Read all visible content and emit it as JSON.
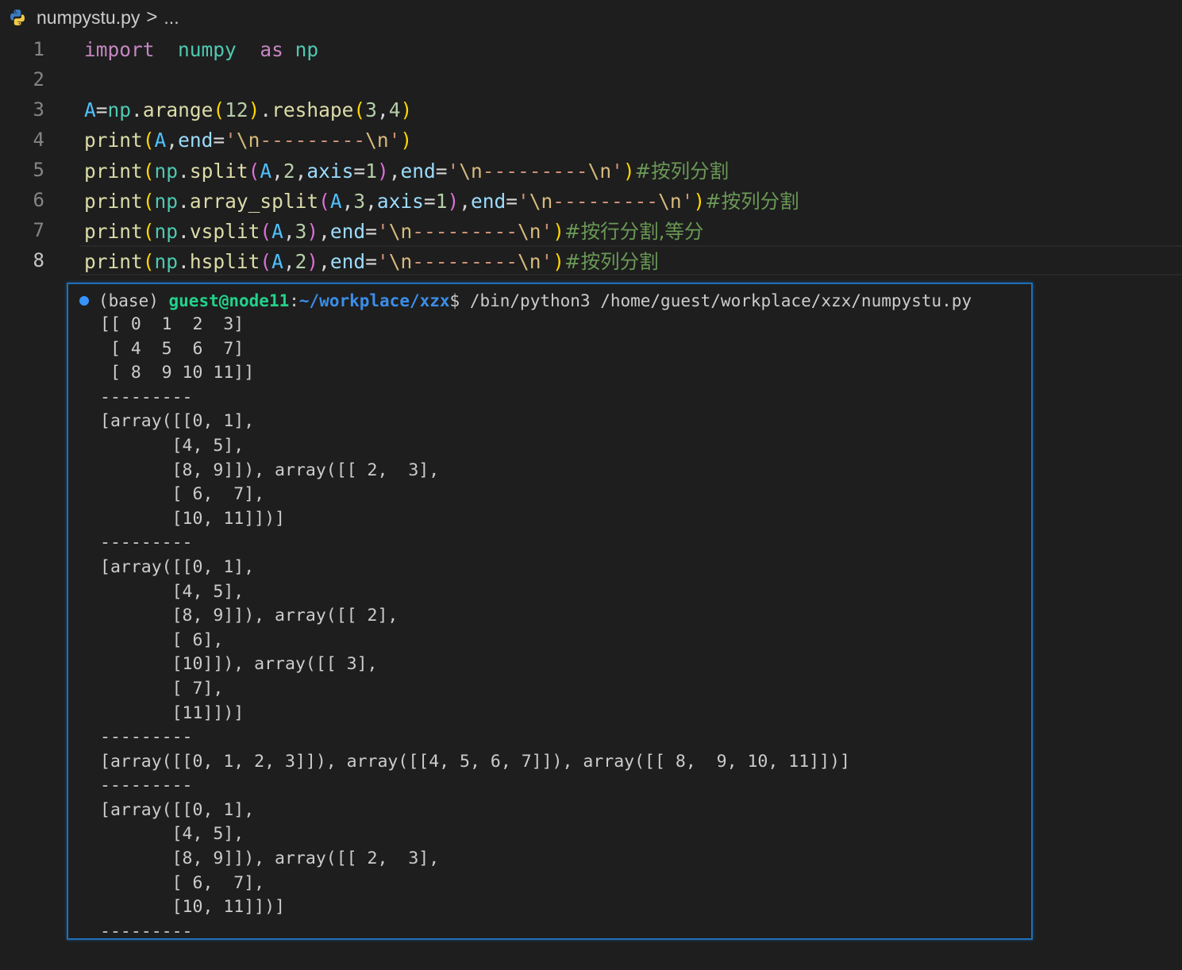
{
  "breadcrumb": {
    "file": "numpystu.py",
    "ellipsis": "..."
  },
  "editor": {
    "active_line": 8,
    "lines": [
      {
        "no": "1",
        "tokens": [
          [
            "kw",
            "import"
          ],
          [
            "",
            "  "
          ],
          [
            "mod",
            "numpy"
          ],
          [
            "",
            "  "
          ],
          [
            "kw",
            "as"
          ],
          [
            "",
            " "
          ],
          [
            "mod",
            "np"
          ]
        ]
      },
      {
        "no": "2",
        "tokens": []
      },
      {
        "no": "3",
        "tokens": [
          [
            "var",
            "A"
          ],
          [
            "",
            "="
          ],
          [
            "mod",
            "np"
          ],
          [
            "",
            "."
          ],
          [
            "fn",
            "arange"
          ],
          [
            "p1",
            "("
          ],
          [
            "num",
            "12"
          ],
          [
            "p1",
            ")"
          ],
          [
            "",
            "."
          ],
          [
            "fn",
            "reshape"
          ],
          [
            "p1",
            "("
          ],
          [
            "num",
            "3"
          ],
          [
            "",
            ","
          ],
          [
            "num",
            "4"
          ],
          [
            "p1",
            ")"
          ]
        ]
      },
      {
        "no": "4",
        "tokens": [
          [
            "fn",
            "print"
          ],
          [
            "p1",
            "("
          ],
          [
            "var",
            "A"
          ],
          [
            "",
            ","
          ],
          [
            "param",
            "end"
          ],
          [
            "",
            "="
          ],
          [
            "str",
            "'"
          ],
          [
            "esc",
            "\\n"
          ],
          [
            "str",
            "---------"
          ],
          [
            "esc",
            "\\n"
          ],
          [
            "str",
            "'"
          ],
          [
            "p1",
            ")"
          ]
        ]
      },
      {
        "no": "5",
        "tokens": [
          [
            "fn",
            "print"
          ],
          [
            "p1",
            "("
          ],
          [
            "mod",
            "np"
          ],
          [
            "",
            "."
          ],
          [
            "fn",
            "split"
          ],
          [
            "p2",
            "("
          ],
          [
            "var",
            "A"
          ],
          [
            "",
            ","
          ],
          [
            "num",
            "2"
          ],
          [
            "",
            ","
          ],
          [
            "param",
            "axis"
          ],
          [
            "",
            "="
          ],
          [
            "num",
            "1"
          ],
          [
            "p2",
            ")"
          ],
          [
            "",
            ","
          ],
          [
            "param",
            "end"
          ],
          [
            "",
            "="
          ],
          [
            "str",
            "'"
          ],
          [
            "esc",
            "\\n"
          ],
          [
            "str",
            "---------"
          ],
          [
            "esc",
            "\\n"
          ],
          [
            "str",
            "'"
          ],
          [
            "p1",
            ")"
          ],
          [
            "cm",
            "#按列分割"
          ]
        ]
      },
      {
        "no": "6",
        "tokens": [
          [
            "fn",
            "print"
          ],
          [
            "p1",
            "("
          ],
          [
            "mod",
            "np"
          ],
          [
            "",
            "."
          ],
          [
            "fn",
            "array_split"
          ],
          [
            "p2",
            "("
          ],
          [
            "var",
            "A"
          ],
          [
            "",
            ","
          ],
          [
            "num",
            "3"
          ],
          [
            "",
            ","
          ],
          [
            "param",
            "axis"
          ],
          [
            "",
            "="
          ],
          [
            "num",
            "1"
          ],
          [
            "p2",
            ")"
          ],
          [
            "",
            ","
          ],
          [
            "param",
            "end"
          ],
          [
            "",
            "="
          ],
          [
            "str",
            "'"
          ],
          [
            "esc",
            "\\n"
          ],
          [
            "str",
            "---------"
          ],
          [
            "esc",
            "\\n"
          ],
          [
            "str",
            "'"
          ],
          [
            "p1",
            ")"
          ],
          [
            "cm",
            "#按列分割"
          ]
        ]
      },
      {
        "no": "7",
        "tokens": [
          [
            "fn",
            "print"
          ],
          [
            "p1",
            "("
          ],
          [
            "mod",
            "np"
          ],
          [
            "",
            "."
          ],
          [
            "fn",
            "vsplit"
          ],
          [
            "p2",
            "("
          ],
          [
            "var",
            "A"
          ],
          [
            "",
            ","
          ],
          [
            "num",
            "3"
          ],
          [
            "p2",
            ")"
          ],
          [
            "",
            ","
          ],
          [
            "param",
            "end"
          ],
          [
            "",
            "="
          ],
          [
            "str",
            "'"
          ],
          [
            "esc",
            "\\n"
          ],
          [
            "str",
            "---------"
          ],
          [
            "esc",
            "\\n"
          ],
          [
            "str",
            "'"
          ],
          [
            "p1",
            ")"
          ],
          [
            "cm",
            "#按行分割,等分"
          ]
        ]
      },
      {
        "no": "8",
        "tokens": [
          [
            "fn",
            "print"
          ],
          [
            "p1",
            "("
          ],
          [
            "mod",
            "np"
          ],
          [
            "",
            "."
          ],
          [
            "fn",
            "hsplit"
          ],
          [
            "p2",
            "("
          ],
          [
            "var",
            "A"
          ],
          [
            "",
            ","
          ],
          [
            "num",
            "2"
          ],
          [
            "p2",
            ")"
          ],
          [
            "",
            ","
          ],
          [
            "param",
            "end"
          ],
          [
            "",
            "="
          ],
          [
            "str",
            "'"
          ],
          [
            "esc",
            "\\n"
          ],
          [
            "str",
            "---------"
          ],
          [
            "esc",
            "\\n"
          ],
          [
            "str",
            "'"
          ],
          [
            "p1",
            ")"
          ],
          [
            "cm",
            "#按列分割"
          ]
        ]
      }
    ]
  },
  "terminal": {
    "env": "(base) ",
    "user": "guest@node11",
    "colon": ":",
    "cwd": "~/workplace/xzx",
    "dollar": "$ ",
    "command": "/bin/python3 /home/guest/workplace/xzx/numpystu.py",
    "output": "[[ 0  1  2  3]\n [ 4  5  6  7]\n [ 8  9 10 11]]\n---------\n[array([[0, 1],\n       [4, 5],\n       [8, 9]]), array([[ 2,  3],\n       [ 6,  7],\n       [10, 11]])]\n---------\n[array([[0, 1],\n       [4, 5],\n       [8, 9]]), array([[ 2],\n       [ 6],\n       [10]]), array([[ 3],\n       [ 7],\n       [11]])]\n---------\n[array([[0, 1, 2, 3]]), array([[4, 5, 6, 7]]), array([[ 8,  9, 10, 11]])]\n---------\n[array([[0, 1],\n       [4, 5],\n       [8, 9]]), array([[ 2,  3],\n       [ 6,  7],\n       [10, 11]])]\n---------"
  }
}
